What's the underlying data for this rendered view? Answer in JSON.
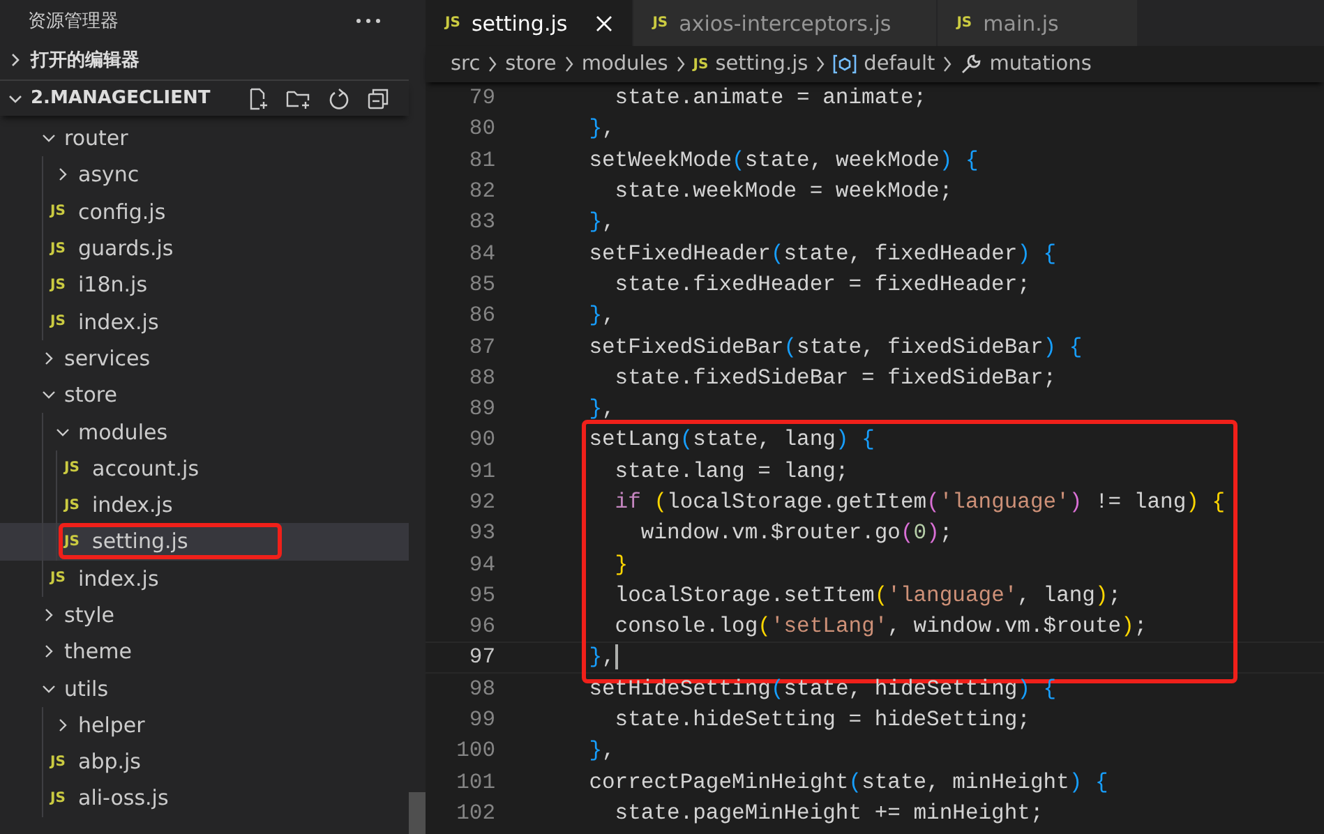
{
  "explorer": {
    "title": "资源管理器",
    "sections": [
      {
        "label": "打开的编辑器",
        "expanded": false
      },
      {
        "label": "2.MANAGECLIENT",
        "expanded": true
      }
    ],
    "tree": [
      {
        "name": "router",
        "kind": "folder",
        "expanded": true,
        "selected": false,
        "highlighted": false,
        "children": [
          {
            "name": "async",
            "kind": "folder",
            "expanded": false,
            "selected": false,
            "highlighted": false
          },
          {
            "name": "config.js",
            "kind": "file",
            "badge": "JS",
            "selected": false,
            "highlighted": false
          },
          {
            "name": "guards.js",
            "kind": "file",
            "badge": "JS",
            "selected": false,
            "highlighted": false
          },
          {
            "name": "i18n.js",
            "kind": "file",
            "badge": "JS",
            "selected": false,
            "highlighted": false
          },
          {
            "name": "index.js",
            "kind": "file",
            "badge": "JS",
            "selected": false,
            "highlighted": false
          }
        ]
      },
      {
        "name": "services",
        "kind": "folder",
        "expanded": false,
        "selected": false,
        "highlighted": false
      },
      {
        "name": "store",
        "kind": "folder",
        "expanded": true,
        "selected": false,
        "highlighted": false,
        "children": [
          {
            "name": "modules",
            "kind": "folder",
            "expanded": true,
            "selected": false,
            "highlighted": false,
            "children": [
              {
                "name": "account.js",
                "kind": "file",
                "badge": "JS",
                "selected": false,
                "highlighted": false
              },
              {
                "name": "index.js",
                "kind": "file",
                "badge": "JS",
                "selected": false,
                "highlighted": false
              },
              {
                "name": "setting.js",
                "kind": "file",
                "badge": "JS",
                "selected": true,
                "highlighted": true
              }
            ]
          },
          {
            "name": "index.js",
            "kind": "file",
            "badge": "JS",
            "selected": false,
            "highlighted": false
          }
        ]
      },
      {
        "name": "style",
        "kind": "folder",
        "expanded": false,
        "selected": false,
        "highlighted": false
      },
      {
        "name": "theme",
        "kind": "folder",
        "expanded": false,
        "selected": false,
        "highlighted": false
      },
      {
        "name": "utils",
        "kind": "folder",
        "expanded": true,
        "selected": false,
        "highlighted": false,
        "children": [
          {
            "name": "helper",
            "kind": "folder",
            "expanded": false,
            "selected": false,
            "highlighted": false
          },
          {
            "name": "abp.js",
            "kind": "file",
            "badge": "JS",
            "selected": false,
            "highlighted": false
          },
          {
            "name": "ali-oss.js",
            "kind": "file",
            "badge": "JS",
            "selected": false,
            "highlighted": false
          }
        ]
      }
    ]
  },
  "tabs": [
    {
      "label": "setting.js",
      "badge": "JS",
      "selected": true
    },
    {
      "label": "axios-interceptors.js",
      "badge": "JS",
      "selected": false
    },
    {
      "label": "main.js",
      "badge": "JS",
      "selected": false
    }
  ],
  "breadcrumbs": [
    {
      "kind": "folder",
      "label": "src"
    },
    {
      "kind": "folder",
      "label": "store"
    },
    {
      "kind": "folder",
      "label": "modules"
    },
    {
      "kind": "file",
      "label": "setting.js",
      "badge": "JS"
    },
    {
      "kind": "symbol",
      "label": "default"
    },
    {
      "kind": "method",
      "label": "mutations"
    }
  ],
  "code": {
    "blocks": [
      {
        "highlighted": false,
        "lines": [
          {
            "number": "79",
            "current": false,
            "tokens": [
              {
                "t": "      state.animate = animate;",
                "color": "#d4d4d4"
              }
            ]
          },
          {
            "number": "80",
            "current": false,
            "tokens": [
              {
                "t": "    }",
                "color": "#179fff"
              },
              {
                "t": ",",
                "color": "#d4d4d4"
              }
            ]
          },
          {
            "number": "81",
            "current": false,
            "tokens": [
              {
                "t": "    setWeekMode",
                "color": "#d4d4d4"
              },
              {
                "t": "(",
                "color": "#179fff"
              },
              {
                "t": "state, weekMode",
                "color": "#d4d4d4"
              },
              {
                "t": ") {",
                "color": "#179fff"
              }
            ]
          },
          {
            "number": "82",
            "current": false,
            "tokens": [
              {
                "t": "      state.weekMode = weekMode;",
                "color": "#d4d4d4"
              }
            ]
          },
          {
            "number": "83",
            "current": false,
            "tokens": [
              {
                "t": "    }",
                "color": "#179fff"
              },
              {
                "t": ",",
                "color": "#d4d4d4"
              }
            ]
          },
          {
            "number": "84",
            "current": false,
            "tokens": [
              {
                "t": "    setFixedHeader",
                "color": "#d4d4d4"
              },
              {
                "t": "(",
                "color": "#179fff"
              },
              {
                "t": "state, fixedHeader",
                "color": "#d4d4d4"
              },
              {
                "t": ") {",
                "color": "#179fff"
              }
            ]
          },
          {
            "number": "85",
            "current": false,
            "tokens": [
              {
                "t": "      state.fixedHeader = fixedHeader;",
                "color": "#d4d4d4"
              }
            ]
          },
          {
            "number": "86",
            "current": false,
            "tokens": [
              {
                "t": "    }",
                "color": "#179fff"
              },
              {
                "t": ",",
                "color": "#d4d4d4"
              }
            ]
          },
          {
            "number": "87",
            "current": false,
            "tokens": [
              {
                "t": "    setFixedSideBar",
                "color": "#d4d4d4"
              },
              {
                "t": "(",
                "color": "#179fff"
              },
              {
                "t": "state, fixedSideBar",
                "color": "#d4d4d4"
              },
              {
                "t": ") {",
                "color": "#179fff"
              }
            ]
          },
          {
            "number": "88",
            "current": false,
            "tokens": [
              {
                "t": "      state.fixedSideBar = fixedSideBar;",
                "color": "#d4d4d4"
              }
            ]
          },
          {
            "number": "89",
            "current": false,
            "tokens": [
              {
                "t": "    }",
                "color": "#179fff"
              },
              {
                "t": ",",
                "color": "#d4d4d4"
              }
            ]
          }
        ]
      },
      {
        "highlighted": true,
        "lines": [
          {
            "number": "90",
            "current": false,
            "tokens": [
              {
                "t": "    setLang",
                "color": "#d4d4d4"
              },
              {
                "t": "(",
                "color": "#179fff"
              },
              {
                "t": "state, lang",
                "color": "#d4d4d4"
              },
              {
                "t": ") {",
                "color": "#179fff"
              }
            ]
          },
          {
            "number": "91",
            "current": false,
            "tokens": [
              {
                "t": "      state.lang = lang;",
                "color": "#d4d4d4"
              }
            ]
          },
          {
            "number": "92",
            "current": false,
            "tokens": [
              {
                "t": "      if",
                "color": "#c586c0"
              },
              {
                "t": " (",
                "color": "#ffd700"
              },
              {
                "t": "localStorage.getItem",
                "color": "#d4d4d4"
              },
              {
                "t": "(",
                "color": "#da70d6"
              },
              {
                "t": "'language'",
                "color": "#ce9178"
              },
              {
                "t": ")",
                "color": "#da70d6"
              },
              {
                "t": " != lang",
                "color": "#d4d4d4"
              },
              {
                "t": ") {",
                "color": "#ffd700"
              }
            ]
          },
          {
            "number": "93",
            "current": false,
            "tokens": [
              {
                "t": "        window.vm.$router.go",
                "color": "#d4d4d4"
              },
              {
                "t": "(",
                "color": "#da70d6"
              },
              {
                "t": "0",
                "color": "#b5cea8"
              },
              {
                "t": ")",
                "color": "#da70d6"
              },
              {
                "t": ";",
                "color": "#d4d4d4"
              }
            ]
          },
          {
            "number": "94",
            "current": false,
            "tokens": [
              {
                "t": "      }",
                "color": "#ffd700"
              }
            ]
          },
          {
            "number": "95",
            "current": false,
            "tokens": [
              {
                "t": "      localStorage.setItem",
                "color": "#d4d4d4"
              },
              {
                "t": "(",
                "color": "#ffd700"
              },
              {
                "t": "'language'",
                "color": "#ce9178"
              },
              {
                "t": ", lang",
                "color": "#d4d4d4"
              },
              {
                "t": ")",
                "color": "#ffd700"
              },
              {
                "t": ";",
                "color": "#d4d4d4"
              }
            ]
          },
          {
            "number": "96",
            "current": false,
            "tokens": [
              {
                "t": "      console.log",
                "color": "#d4d4d4"
              },
              {
                "t": "(",
                "color": "#ffd700"
              },
              {
                "t": "'setLang'",
                "color": "#ce9178"
              },
              {
                "t": ", window.vm.$route",
                "color": "#d4d4d4"
              },
              {
                "t": ")",
                "color": "#ffd700"
              },
              {
                "t": ";",
                "color": "#d4d4d4"
              }
            ]
          },
          {
            "number": "97",
            "current": true,
            "tokens": [
              {
                "t": "    }",
                "color": "#179fff"
              },
              {
                "t": ",",
                "color": "#d4d4d4"
              }
            ]
          }
        ]
      },
      {
        "highlighted": false,
        "lines": [
          {
            "number": "98",
            "current": false,
            "tokens": [
              {
                "t": "    setHideSetting",
                "color": "#d4d4d4"
              },
              {
                "t": "(",
                "color": "#179fff"
              },
              {
                "t": "state, hideSetting",
                "color": "#d4d4d4"
              },
              {
                "t": ") {",
                "color": "#179fff"
              }
            ]
          },
          {
            "number": "99",
            "current": false,
            "tokens": [
              {
                "t": "      state.hideSetting = hideSetting;",
                "color": "#d4d4d4"
              }
            ]
          },
          {
            "number": "100",
            "current": false,
            "tokens": [
              {
                "t": "    }",
                "color": "#179fff"
              },
              {
                "t": ",",
                "color": "#d4d4d4"
              }
            ]
          },
          {
            "number": "101",
            "current": false,
            "tokens": [
              {
                "t": "    correctPageMinHeight",
                "color": "#d4d4d4"
              },
              {
                "t": "(",
                "color": "#179fff"
              },
              {
                "t": "state, minHeight",
                "color": "#d4d4d4"
              },
              {
                "t": ") {",
                "color": "#179fff"
              }
            ]
          },
          {
            "number": "102",
            "current": false,
            "tokens": [
              {
                "t": "      state.pageMinHeight += minHeight;",
                "color": "#d4d4d4"
              }
            ]
          }
        ]
      }
    ]
  }
}
